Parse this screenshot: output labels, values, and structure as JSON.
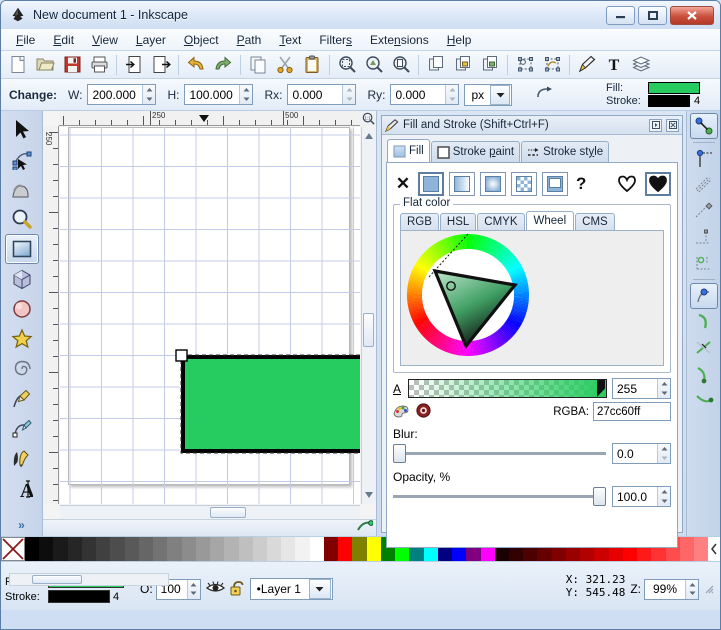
{
  "window": {
    "title": "New document 1 - Inkscape",
    "logo_icon": "inkscape-logo-icon",
    "minimize_label": "minimize-icon",
    "maximize_label": "maximize-icon",
    "close_label": "close-icon"
  },
  "menu": [
    {
      "label": "File",
      "accel": "F"
    },
    {
      "label": "Edit",
      "accel": "E"
    },
    {
      "label": "View",
      "accel": "V"
    },
    {
      "label": "Layer",
      "accel": "L"
    },
    {
      "label": "Object",
      "accel": "O"
    },
    {
      "label": "Path",
      "accel": "P"
    },
    {
      "label": "Text",
      "accel": "T"
    },
    {
      "label": "Filters",
      "accel": "s"
    },
    {
      "label": "Extensions",
      "accel": "n"
    },
    {
      "label": "Help",
      "accel": "H"
    }
  ],
  "commands": [
    {
      "name": "new-document-button",
      "icon": "new-document-icon"
    },
    {
      "name": "open-document-button",
      "icon": "open-folder-icon"
    },
    {
      "name": "save-document-button",
      "icon": "save-floppy-icon"
    },
    {
      "name": "print-document-button",
      "icon": "printer-icon"
    },
    {
      "sep": true
    },
    {
      "name": "import-button",
      "icon": "import-icon"
    },
    {
      "name": "export-button",
      "icon": "export-icon"
    },
    {
      "sep": true
    },
    {
      "name": "undo-button",
      "icon": "undo-arrow-icon"
    },
    {
      "name": "redo-button",
      "icon": "redo-arrow-icon"
    },
    {
      "sep": true
    },
    {
      "name": "copy-button",
      "icon": "copy-icon"
    },
    {
      "name": "cut-button",
      "icon": "scissors-icon"
    },
    {
      "name": "paste-button",
      "icon": "clipboard-icon"
    },
    {
      "sep": true
    },
    {
      "name": "zoom-selection-button",
      "icon": "zoom-selection-icon"
    },
    {
      "name": "zoom-drawing-button",
      "icon": "zoom-drawing-icon"
    },
    {
      "name": "zoom-page-button",
      "icon": "zoom-page-icon"
    },
    {
      "sep": true
    },
    {
      "name": "duplicate-button",
      "icon": "duplicate-icon"
    },
    {
      "name": "clone-button",
      "icon": "clone-lock-icon"
    },
    {
      "name": "unlink-clone-button",
      "icon": "unlink-clone-icon"
    },
    {
      "sep": true
    },
    {
      "name": "group-button",
      "icon": "group-icon"
    },
    {
      "name": "ungroup-button",
      "icon": "ungroup-icon"
    },
    {
      "sep": true
    },
    {
      "name": "fill-and-stroke-button",
      "icon": "fill-stroke-pen-icon"
    },
    {
      "name": "text-tool-button",
      "icon": "text-T-icon"
    },
    {
      "name": "layers-button",
      "icon": "layers-stack-icon"
    }
  ],
  "tool_options": {
    "change_label": "Change:",
    "w_label": "W:",
    "w_value": "200.000",
    "h_label": "H:",
    "h_value": "100.000",
    "rx_label": "Rx:",
    "rx_value": "0.000",
    "ry_label": "Ry:",
    "ry_value": "0.000",
    "unit_value": "px",
    "not_rounded_icon": "not-rounded-icon"
  },
  "fill_stroke_indicator_top": {
    "fill_label": "Fill:",
    "stroke_label": "Stroke:",
    "fill_color": "#27cc60",
    "stroke_color": "#000000",
    "stroke_width": "4"
  },
  "toolbox": [
    {
      "name": "tool-selector",
      "icon": "arrow-pointer-icon",
      "active": false
    },
    {
      "name": "tool-node-editor",
      "icon": "node-editor-icon",
      "active": false
    },
    {
      "name": "tool-tweak",
      "icon": "tweak-icon",
      "active": false
    },
    {
      "name": "tool-zoom",
      "icon": "magnifier-icon",
      "active": false
    },
    {
      "name": "tool-rectangle",
      "icon": "rectangle-icon",
      "active": true
    },
    {
      "name": "tool-3dbox",
      "icon": "cube-3d-icon",
      "active": false
    },
    {
      "name": "tool-ellipse",
      "icon": "ellipse-icon",
      "active": false
    },
    {
      "name": "tool-star",
      "icon": "star-icon",
      "active": false
    },
    {
      "name": "tool-spiral",
      "icon": "spiral-icon",
      "active": false
    },
    {
      "name": "tool-pencil",
      "icon": "pencil-icon",
      "active": false
    },
    {
      "name": "tool-bezier",
      "icon": "bezier-pen-icon",
      "active": false
    },
    {
      "name": "tool-calligraphy",
      "icon": "calligraphy-pen-icon",
      "active": false
    },
    {
      "name": "tool-text",
      "icon": "text-A-icon",
      "active": false
    }
  ],
  "toolbox_more_label": "»",
  "canvas": {
    "ruler_labels_h": [
      "250",
      "500"
    ],
    "ruler_labels_v": [
      "250"
    ],
    "zoom_fit_icon": "zoom-1to1-icon",
    "object_fill": "#27cc60",
    "object_stroke": "#000000"
  },
  "dialog": {
    "title": "Fill and Stroke (Shift+Ctrl+F)",
    "title_icon": "fill-stroke-pen-icon",
    "collapse_icon": "collapse-icon",
    "close_icon": "close-icon",
    "tabs": [
      {
        "label": "Fill",
        "accel": "",
        "icon": "fill-square-icon",
        "active": true
      },
      {
        "label": "Stroke paint",
        "accel": "p",
        "icon": "stroke-paint-icon",
        "active": false
      },
      {
        "label": "Stroke style",
        "accel": "y",
        "icon": "stroke-style-icon",
        "active": false
      }
    ],
    "paint_buttons": [
      {
        "name": "paint-none-button",
        "icon": "x-no-paint-icon",
        "selected": false
      },
      {
        "name": "paint-flat-color-button",
        "icon": "flat-color-icon",
        "selected": true
      },
      {
        "name": "paint-linear-gradient-button",
        "icon": "linear-gradient-icon",
        "selected": false
      },
      {
        "name": "paint-radial-gradient-button",
        "icon": "radial-gradient-icon",
        "selected": false
      },
      {
        "name": "paint-pattern-button",
        "icon": "pattern-icon",
        "selected": false
      },
      {
        "name": "paint-swatch-button",
        "icon": "swatch-icon",
        "selected": false
      },
      {
        "name": "paint-unknown-button",
        "icon": "question-mark-icon",
        "selected": false
      }
    ],
    "fillrule_buttons": [
      {
        "name": "fillrule-evenodd-button",
        "icon": "evenodd-heart-outline-icon",
        "selected": false
      },
      {
        "name": "fillrule-nonzero-button",
        "icon": "nonzero-heart-solid-icon",
        "selected": true
      }
    ],
    "flat_color_legend": "Flat color",
    "color_tabs": [
      {
        "label": "RGB",
        "active": false
      },
      {
        "label": "HSL",
        "active": false
      },
      {
        "label": "CMYK",
        "active": false
      },
      {
        "label": "Wheel",
        "active": true
      },
      {
        "label": "CMS",
        "active": false
      }
    ],
    "alpha_label": "A",
    "alpha_value": "255",
    "rgba_label": "RGBA:",
    "rgba_value": "27cc60ff",
    "picker_icons": [
      {
        "name": "color-picker-button",
        "icon": "eyedropper-palette-icon"
      },
      {
        "name": "color-wheel-reset-button",
        "icon": "target-circle-icon"
      }
    ],
    "blur_label": "Blur:",
    "blur_value": "0.0",
    "opacity_label": "Opacity, %",
    "opacity_value": "100.0"
  },
  "palette": {
    "none_icon": "x-no-color-icon",
    "colors": [
      "#000000",
      "#0d0d0d",
      "#1a1a1a",
      "#262626",
      "#333333",
      "#404040",
      "#4d4d4d",
      "#595959",
      "#666666",
      "#737373",
      "#808080",
      "#8c8c8c",
      "#999999",
      "#a6a6a6",
      "#b3b3b3",
      "#bfbfbf",
      "#cccccc",
      "#d9d9d9",
      "#e6e6e6",
      "#f2f2f2",
      "#ffffff",
      "#800000",
      "#ff0000",
      "#808000",
      "#ffff00",
      "#008000",
      "#00ff00",
      "#008080",
      "#00ffff",
      "#000080",
      "#0000ff",
      "#800080",
      "#ff00ff",
      "#1a0000",
      "#330000",
      "#4d0000",
      "#660000",
      "#800000",
      "#990000",
      "#b30000",
      "#cc0000",
      "#e60000",
      "#ff0000",
      "#ff1a1a",
      "#ff3333",
      "#ff4d4d",
      "#ff6666",
      "#ff8080"
    ],
    "scroll_icon": "palette-scroll-icon"
  },
  "statusbar": {
    "fill_label": "Fill:",
    "stroke_label": "Stroke:",
    "fill_color": "#27cc60",
    "stroke_color": "#000000",
    "stroke_width": "4",
    "opacity_label": "O:",
    "opacity_value": "100",
    "visibility_icon": "eye-icon",
    "lock_icon": "unlocked-padlock-icon",
    "layer_value": "Layer 1",
    "layer_bullet": "•",
    "x_label": "X:",
    "x_value": "321.23",
    "y_label": "Y:",
    "y_value": "545.48",
    "z_label": "Z:",
    "zoom_value": "99%",
    "resize_grip_icon": "resize-grip-icon"
  },
  "snapbar": [
    {
      "name": "snap-enable-global",
      "icon": "snap-global-icon",
      "active": true
    },
    {
      "name": "snap-bounding-box",
      "icon": "snap-bbox-icon",
      "active": false
    },
    {
      "name": "snap-bbox-edges",
      "icon": "snap-bbox-edge-icon",
      "active": false
    },
    {
      "name": "snap-bbox-corners",
      "icon": "snap-bbox-corner-icon",
      "active": false
    },
    {
      "name": "snap-bbox-edge-midpoints",
      "icon": "snap-bbox-midpoint-icon",
      "active": false
    },
    {
      "name": "snap-bbox-centers",
      "icon": "snap-bbox-center-icon",
      "active": false
    },
    {
      "name": "snap-nodes-paths",
      "icon": "snap-node-icon",
      "active": true
    },
    {
      "name": "snap-paths",
      "icon": "snap-path-icon",
      "active": false
    },
    {
      "name": "snap-path-intersections",
      "icon": "snap-intersection-icon",
      "active": false
    },
    {
      "name": "snap-cusp-nodes",
      "icon": "snap-cusp-icon",
      "active": false
    },
    {
      "name": "snap-smooth-nodes",
      "icon": "snap-smooth-icon",
      "active": false
    }
  ]
}
